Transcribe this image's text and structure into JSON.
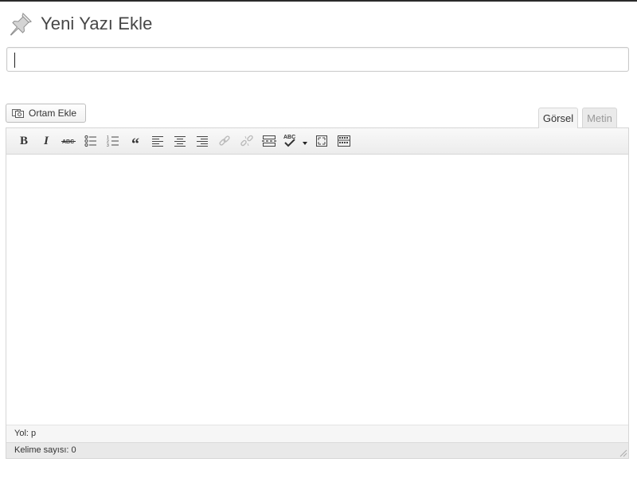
{
  "page": {
    "title": "Yeni Yazı Ekle"
  },
  "title_field": {
    "value": "",
    "placeholder": ""
  },
  "media": {
    "add_media_label": "Ortam Ekle"
  },
  "editor_tabs": [
    {
      "label": "Görsel",
      "active": true
    },
    {
      "label": "Metin",
      "active": false
    }
  ],
  "toolbar": {
    "bold": "B",
    "italic": "I",
    "strikethrough": "ABC",
    "blockquote": "“",
    "spellcheck": "ABC",
    "buttons": [
      "bold",
      "italic",
      "strikethrough",
      "bullet-list",
      "numbered-list",
      "blockquote",
      "align-left",
      "align-center",
      "align-right",
      "insert-link",
      "remove-link",
      "insert-more",
      "spellcheck",
      "fullscreen",
      "toolbar-toggle"
    ],
    "disabled": [
      "insert-link",
      "remove-link"
    ]
  },
  "status": {
    "path": "Yol: p",
    "word_count": "Kelime sayısı: 0"
  }
}
